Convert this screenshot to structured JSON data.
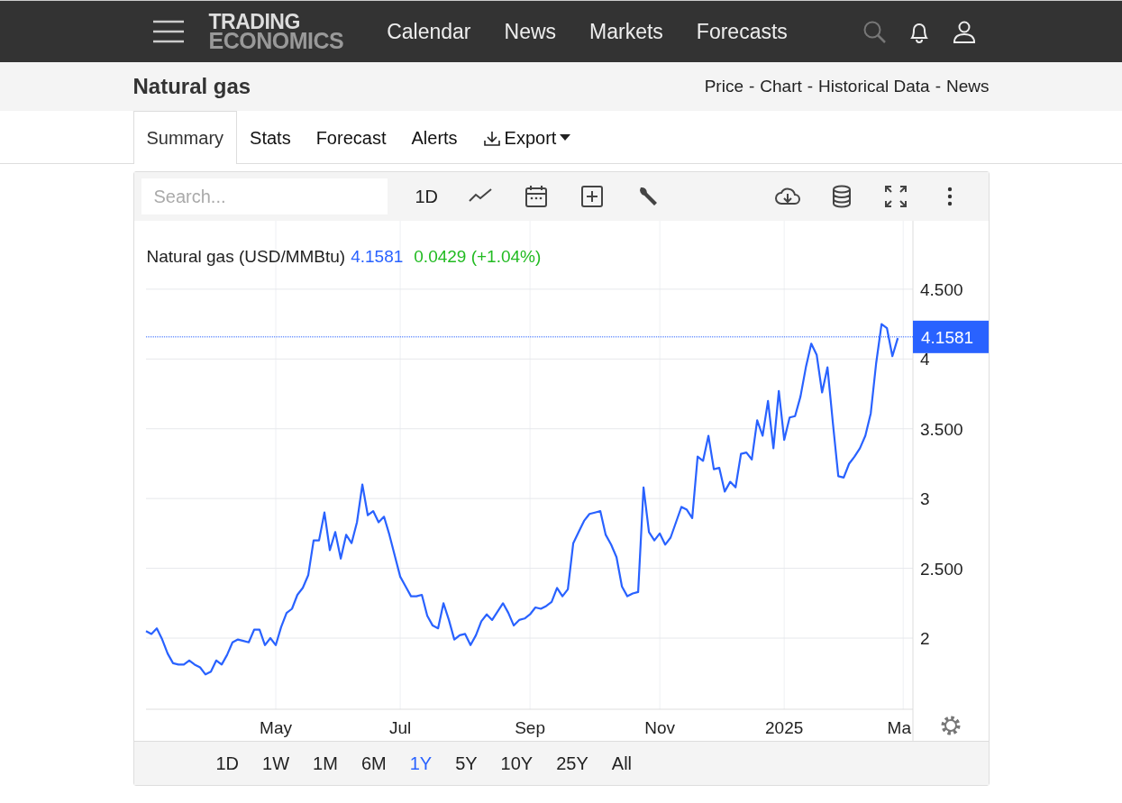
{
  "nav": {
    "logo": {
      "line1": "TRADING",
      "line2": "ECONOMICS"
    },
    "links": [
      "Calendar",
      "News",
      "Markets",
      "Forecasts"
    ]
  },
  "header": {
    "title": "Natural gas",
    "links": [
      "Price",
      "Chart",
      "Historical Data",
      "News"
    ],
    "separator": "-"
  },
  "tabs": [
    {
      "label": "Summary",
      "selected": true,
      "kind": "tab"
    },
    {
      "label": "Stats",
      "selected": false,
      "kind": "tab"
    },
    {
      "label": "Forecast",
      "selected": false,
      "kind": "tab"
    },
    {
      "label": "Alerts",
      "selected": false,
      "kind": "tab"
    },
    {
      "label": "Export",
      "selected": false,
      "kind": "dropdown"
    }
  ],
  "toolbar": {
    "search": {
      "placeholder": "Search..."
    },
    "interval": "1D"
  },
  "legend": {
    "name": "Natural gas (USD/MMBtu)",
    "price": "4.1581",
    "change": "0.0429 (+1.04%)"
  },
  "last_price": {
    "label": "4.1581"
  },
  "chart_data": {
    "type": "line",
    "grid": true,
    "ref_lines": [
      {
        "axis": "y",
        "value": 4.1581,
        "color": "#2962ff"
      }
    ],
    "ylim": [
      1.49,
      4.99
    ],
    "categories": [
      null,
      null,
      null,
      null,
      null,
      null,
      null,
      null,
      null,
      null,
      null,
      null,
      null,
      null,
      null,
      null,
      null,
      null,
      null,
      null,
      null,
      null,
      null,
      null,
      "May",
      null,
      null,
      null,
      null,
      null,
      null,
      null,
      null,
      null,
      null,
      null,
      null,
      null,
      null,
      null,
      null,
      null,
      null,
      null,
      null,
      null,
      null,
      "Jul",
      null,
      null,
      null,
      null,
      null,
      null,
      null,
      null,
      null,
      null,
      null,
      null,
      null,
      null,
      null,
      null,
      null,
      null,
      null,
      null,
      null,
      null,
      null,
      "Sep",
      null,
      null,
      null,
      null,
      null,
      null,
      null,
      null,
      null,
      null,
      null,
      null,
      null,
      null,
      null,
      null,
      null,
      null,
      null,
      null,
      null,
      null,
      null,
      "Nov",
      null,
      null,
      null,
      null,
      null,
      null,
      null,
      null,
      null,
      null,
      null,
      null,
      null,
      null,
      null,
      null,
      null,
      null,
      null,
      null,
      null,
      null,
      "2025",
      null,
      null,
      null,
      null,
      null,
      null,
      null,
      null,
      null,
      null,
      null,
      null,
      null,
      null,
      null,
      null,
      null,
      null,
      null,
      null,
      null,
      "Ma"
    ],
    "yticks": [
      {
        "value": 2,
        "label": "2"
      },
      {
        "value": 2.5,
        "label": "2.500"
      },
      {
        "value": 3,
        "label": "3"
      },
      {
        "value": 3.5,
        "label": "3.500"
      },
      {
        "value": 4,
        "label": "4"
      },
      {
        "value": 4.5,
        "label": "4.500"
      }
    ],
    "series": [
      {
        "color": "#2962ff",
        "values": [
          2.05,
          2.03,
          2.07,
          1.99,
          1.89,
          1.82,
          1.81,
          1.81,
          1.84,
          1.81,
          1.79,
          1.74,
          1.76,
          1.84,
          1.81,
          1.88,
          1.97,
          1.99,
          1.98,
          1.97,
          2.06,
          2.06,
          1.95,
          2.0,
          1.95,
          2.08,
          2.18,
          2.21,
          2.31,
          2.36,
          2.45,
          2.7,
          2.7,
          2.9,
          2.63,
          2.76,
          2.57,
          2.74,
          2.68,
          2.83,
          3.1,
          2.88,
          2.91,
          2.83,
          2.87,
          2.74,
          2.59,
          2.44,
          2.37,
          2.3,
          2.3,
          2.31,
          2.16,
          2.09,
          2.07,
          2.25,
          2.13,
          1.99,
          2.02,
          2.03,
          1.95,
          2.02,
          2.12,
          2.17,
          2.13,
          2.19,
          2.25,
          2.18,
          2.09,
          2.13,
          2.14,
          2.17,
          2.22,
          2.21,
          2.23,
          2.26,
          2.36,
          2.3,
          2.35,
          2.68,
          2.76,
          2.84,
          2.89,
          2.9,
          2.91,
          2.74,
          2.67,
          2.58,
          2.37,
          2.3,
          2.32,
          2.33,
          3.08,
          2.76,
          2.7,
          2.75,
          2.67,
          2.72,
          2.83,
          2.94,
          2.92,
          2.86,
          3.3,
          3.27,
          3.45,
          3.21,
          3.22,
          3.05,
          3.12,
          3.08,
          3.32,
          3.33,
          3.28,
          3.56,
          3.45,
          3.7,
          3.36,
          3.77,
          3.42,
          3.58,
          3.59,
          3.73,
          3.94,
          4.11,
          4.03,
          3.76,
          3.94,
          3.54,
          3.16,
          3.15,
          3.25,
          3.3,
          3.36,
          3.45,
          3.61,
          3.97,
          4.25,
          4.22,
          4.02,
          4.15,
          null
        ]
      }
    ]
  },
  "ranges": [
    {
      "label": "1D",
      "selected": false
    },
    {
      "label": "1W",
      "selected": false
    },
    {
      "label": "1M",
      "selected": false
    },
    {
      "label": "6M",
      "selected": false
    },
    {
      "label": "1Y",
      "selected": true
    },
    {
      "label": "5Y",
      "selected": false
    },
    {
      "label": "10Y",
      "selected": false
    },
    {
      "label": "25Y",
      "selected": false
    },
    {
      "label": "All",
      "selected": false
    }
  ]
}
